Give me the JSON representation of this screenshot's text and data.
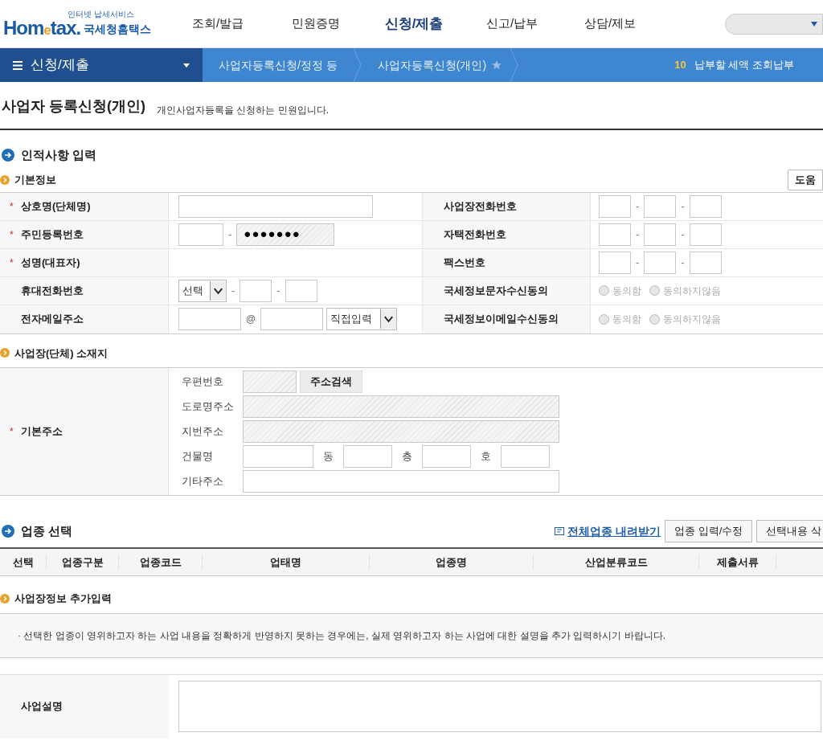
{
  "header": {
    "logo": {
      "tagline": "인터넷 납세서비스",
      "brand_a": "Hom",
      "brand_e": "e",
      "brand_b": "tax.",
      "agency": "국세청홈택스"
    },
    "nav": [
      {
        "label": "조회/발급",
        "selected": false
      },
      {
        "label": "민원증명",
        "selected": false
      },
      {
        "label": "신청/제출",
        "selected": true
      },
      {
        "label": "신고/납부",
        "selected": false
      },
      {
        "label": "상담/제보",
        "selected": false
      }
    ]
  },
  "required_mark": "*",
  "breadcrumb": {
    "menu": "신청/제출",
    "items": [
      {
        "label": "사업자등록신청/정정 등"
      },
      {
        "label": "사업자등록신청(개인)"
      }
    ],
    "count": "10",
    "link": "납부할 세액 조회납부"
  },
  "page": {
    "title": "사업자 등록신청(개인)",
    "subtitle": "개인사업자등록을 신청하는 민원입니다."
  },
  "personal": {
    "title": "인적사항 입력",
    "subtitle": "기본정보",
    "help_button": "도움",
    "left_rows": [
      {
        "label": "상호명(단체명)",
        "required": true,
        "kind": "text"
      },
      {
        "label": "주민등록번호",
        "required": true,
        "kind": "rrn",
        "separator": "-",
        "masked": "●●●●●●●"
      },
      {
        "label": "성명(대표자)",
        "required": true,
        "kind": "none"
      },
      {
        "label": "휴대전화번호",
        "required": false,
        "kind": "mobile",
        "select": "선택",
        "separator": "-"
      },
      {
        "label": "전자메일주소",
        "required": false,
        "kind": "email",
        "at": "@",
        "select": "직접입력"
      }
    ],
    "right_rows": [
      {
        "label": "사업장전화번호",
        "kind": "phone",
        "separator": "-"
      },
      {
        "label": "자택전화번호",
        "kind": "phone",
        "separator": "-"
      },
      {
        "label": "팩스번호",
        "kind": "phone",
        "separator": "-"
      },
      {
        "label": "국세정보문자수신동의",
        "kind": "radio",
        "disabled": true,
        "options": [
          {
            "label": "동의함",
            "selected": false
          },
          {
            "label": "동의하지않음",
            "selected": false
          }
        ]
      },
      {
        "label": "국세정보이메일수신동의",
        "kind": "radio",
        "disabled": true,
        "options": [
          {
            "label": "동의함",
            "selected": false
          },
          {
            "label": "동의하지않음",
            "selected": false
          }
        ]
      }
    ]
  },
  "address": {
    "title": "사업장(단체) 소재지",
    "label": "기본주소",
    "required": true,
    "postcode": {
      "label": "우편번호",
      "readonly": true,
      "button": "주소검색"
    },
    "road": {
      "label": "도로명주소",
      "readonly": true
    },
    "lot": {
      "label": "지번주소",
      "readonly": true
    },
    "building": {
      "label": "건물명",
      "parts": [
        "동",
        "층",
        "호"
      ]
    },
    "other": {
      "label": "기타주소",
      "readonly": false
    }
  },
  "industry": {
    "title": "업종 선택",
    "download_link": "전체업종 내려받기",
    "buttons": [
      "업종 입력/수정",
      "선택내용 삭"
    ],
    "columns": [
      "선택",
      "업종구분",
      "업종코드",
      "업태명",
      "업종명",
      "산업분류코드",
      "제출서류"
    ]
  },
  "extra": {
    "title": "사업장정보 추가입력",
    "note": "· 선택한 업종이 영위하고자 하는 사업 내용을 정확하게 반영하지 못하는 경우에는, 실제 영위하고자 하는 사업에 대한 설명을 추가 입력하시기 바랍니다.",
    "description_label": "사업설명"
  }
}
